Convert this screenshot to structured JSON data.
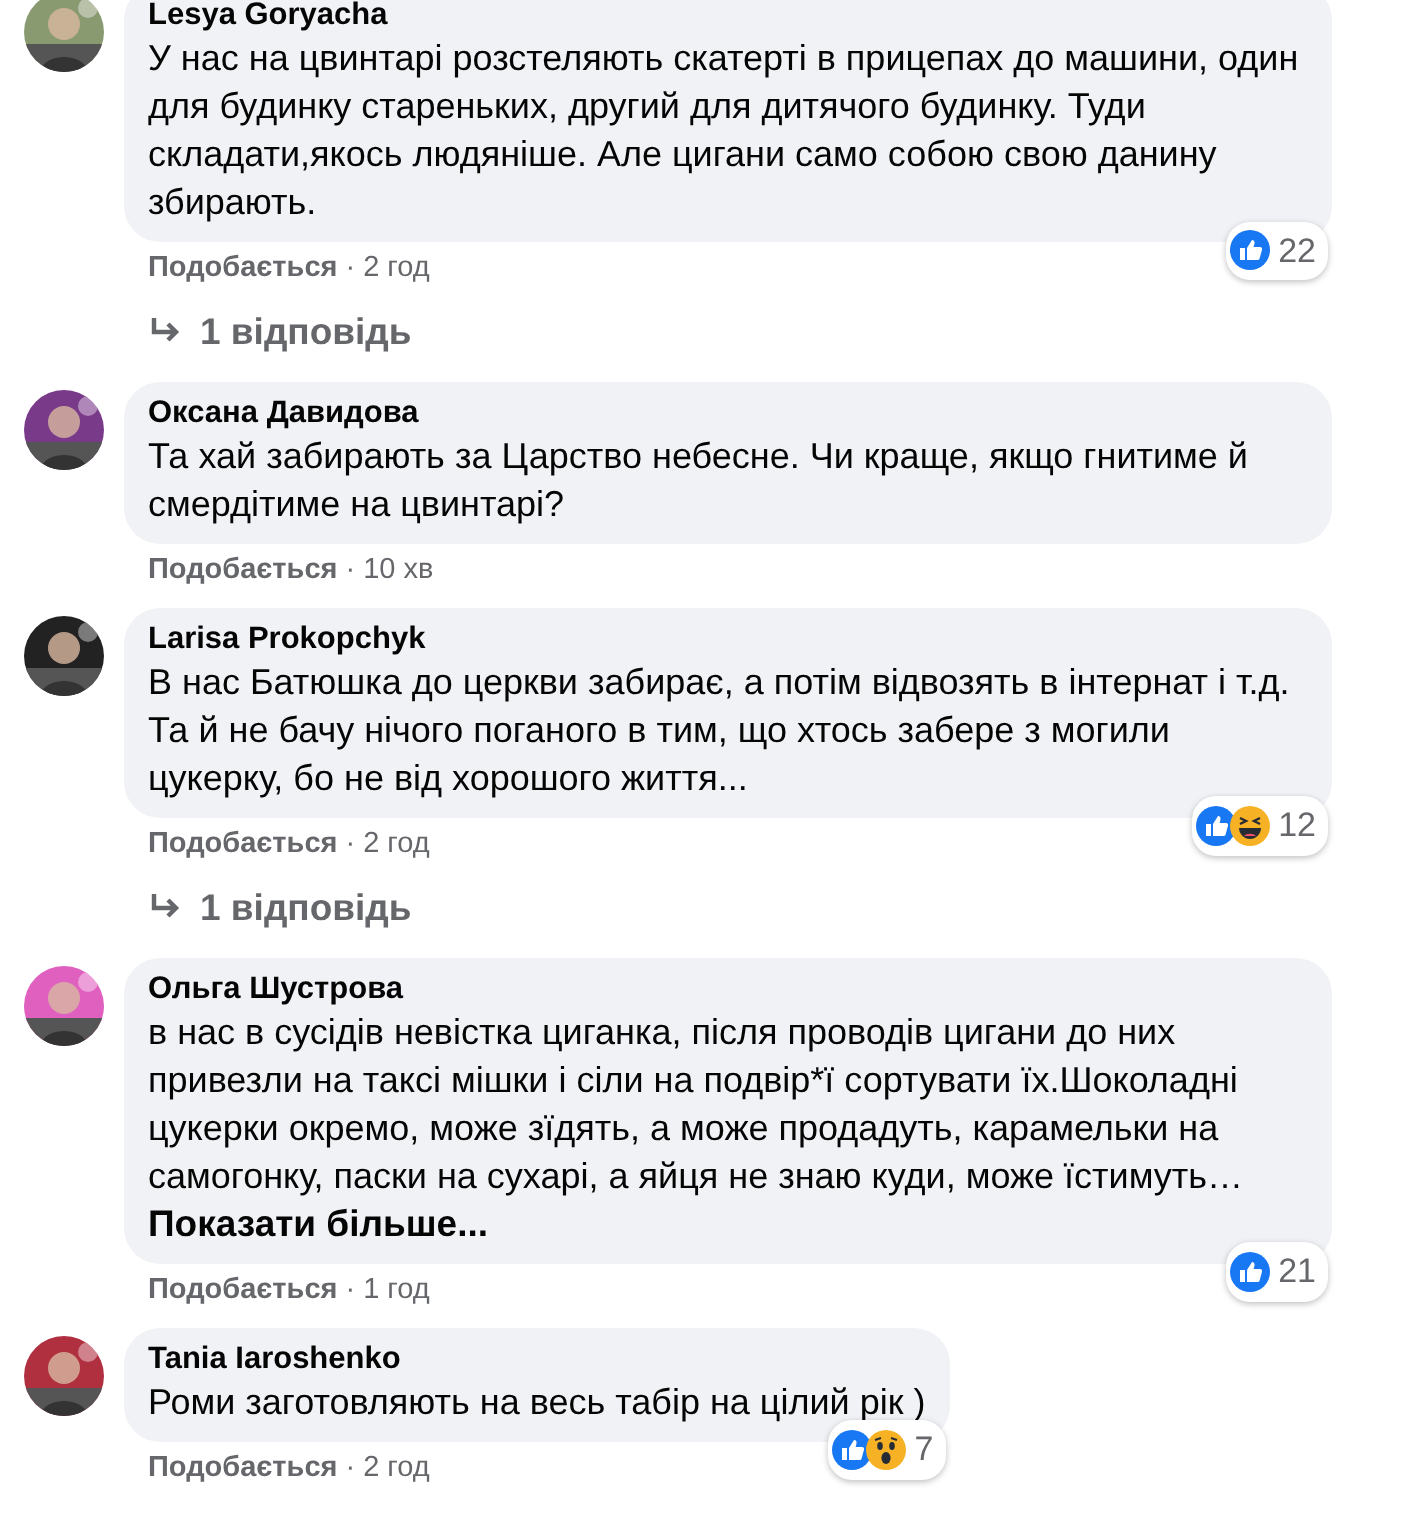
{
  "comments": [
    {
      "author": "Lesya Goryacha",
      "text": "У нас на цвинтарі розстеляють скатерті в прицепах до машини, один для будинку стареньких, другий для дитячого будинку. Туди складати,якось людяніше. Але цигани само собою свою данину збирають.",
      "like_label": "Подобається",
      "time": "· 2 год",
      "reactions": [
        {
          "kind": "like"
        }
      ],
      "reaction_count": "22",
      "replies": "1 відповідь"
    },
    {
      "author": "Оксана Давидова",
      "text": "Та хай забирають за Царство небесне. Чи краще, якщо гнитиме й смердітиме на цвинтарі?",
      "like_label": "Подобається",
      "time": "· 10 хв"
    },
    {
      "author": "Larisa Prokopchyk",
      "text": "В нас Батюшка до церкви забирає, а потім відвозять в інтернат і т.д. Та й не бачу нічого поганого в тим, що хтось забере з могили цукерку, бо не від хорошого життя...",
      "like_label": "Подобається",
      "time": "· 2 год",
      "reactions": [
        {
          "kind": "like"
        },
        {
          "kind": "haha"
        }
      ],
      "reaction_count": "12",
      "replies": "1 відповідь"
    },
    {
      "author": "Ольга Шустрова",
      "text": "в нас в сусідів невістка циганка, після проводів цигани до них привезли на таксі мішки і сіли на подвір*ї сортувати їх.Шоколадні цукерки окремо, може зїдять, а може продадуть, карамельки на самогонку, паски на сухарі, а яйця не знаю куди, може їстимуть…",
      "see_more": "Показати більше...",
      "like_label": "Подобається",
      "time": "· 1 год",
      "reactions": [
        {
          "kind": "like"
        }
      ],
      "reaction_count": "21"
    },
    {
      "author": "Tania Iaroshenko",
      "text": "Роми заготовляють на весь табір на цілий рік )",
      "like_label": "Подобається",
      "time": "· 2 год",
      "reactions": [
        {
          "kind": "like"
        },
        {
          "kind": "wow"
        }
      ],
      "reaction_count": "7"
    }
  ]
}
